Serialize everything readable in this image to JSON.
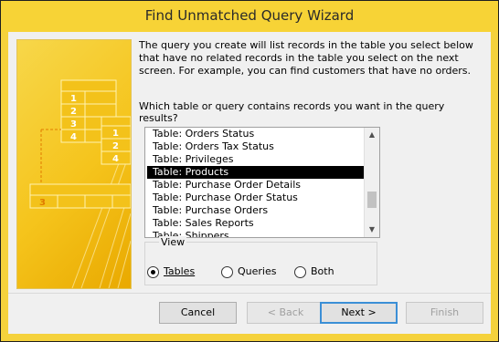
{
  "window": {
    "title": "Find Unmatched Query Wizard"
  },
  "intro_text": "The query you create will list records in the table you select below that have no related records in the table you select on the next screen. For example, you can find customers that have no orders.",
  "question": "Which table or query contains records you want in the query results?",
  "list": {
    "items": [
      "Table: Orders Status",
      "Table: Orders Tax Status",
      "Table: Privileges",
      "Table: Products",
      "Table: Purchase Order Details",
      "Table: Purchase Order Status",
      "Table: Purchase Orders",
      "Table: Sales Reports",
      "Table: Shippers"
    ],
    "selected": "Table: Products"
  },
  "view": {
    "label": "View",
    "options": [
      "Tables",
      "Queries",
      "Both"
    ],
    "selected": "Tables"
  },
  "buttons": {
    "cancel": "Cancel",
    "back": "< Back",
    "next": "Next >",
    "finish": "Finish"
  },
  "illustration": {
    "numbers": [
      "1",
      "2",
      "3",
      "4",
      "1",
      "2",
      "4",
      "3"
    ]
  },
  "colors": {
    "title_bar": "#f7d336",
    "selection": "#000000",
    "default_button_border": "#3b8fd6"
  }
}
